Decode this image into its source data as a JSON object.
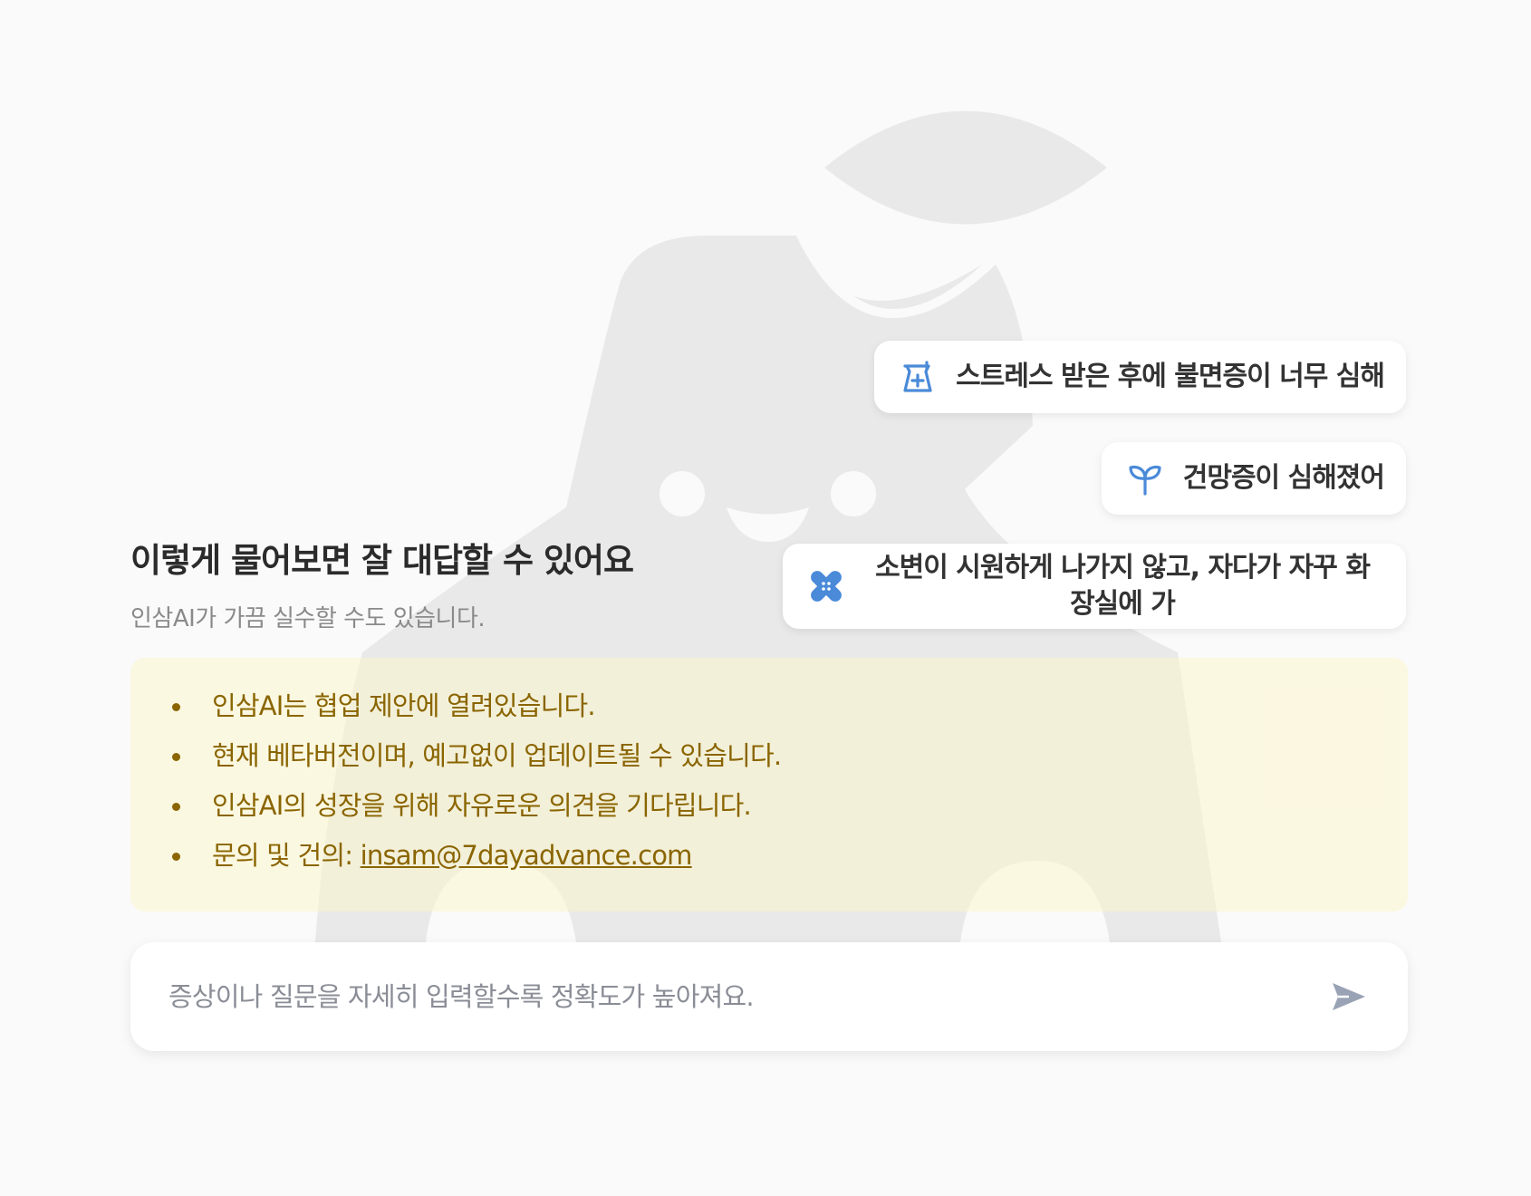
{
  "intro": {
    "title": "이렇게 물어보면 잘 대답할 수 있어요",
    "subtitle": "인삼AI가 가끔 실수할 수도 있습니다."
  },
  "suggestions": [
    {
      "icon": "medicine-jar-icon",
      "label": "스트레스 받은 후에 불면증이 너무 심해"
    },
    {
      "icon": "sprout-icon",
      "label": "건망증이 심해졌어"
    },
    {
      "icon": "bandage-icon",
      "label": "소변이 시원하게 나가지 않고, 자다가 자꾸 화장실에 가"
    }
  ],
  "notice": {
    "items": [
      "인삼AI는 협업 제안에 열려있습니다.",
      "현재 베타버전이며, 예고없이 업데이트될 수 있습니다.",
      "인삼AI의 성장을 위해 자유로운 의견을 기다립니다."
    ],
    "contact_label": "문의 및 건의: ",
    "contact_email": "insam@7dayadvance.com"
  },
  "input": {
    "placeholder": "증상이나 질문을 자세히 입력할수록 정확도가 높아져요.",
    "value": ""
  },
  "colors": {
    "background": "#fafafa",
    "accent_blue": "#4a8ad8",
    "notice_text": "#8a6500",
    "notice_bg": "#fbf5cc",
    "mascot_gray": "#e9e9e9",
    "send_icon": "#9aa3b5"
  }
}
